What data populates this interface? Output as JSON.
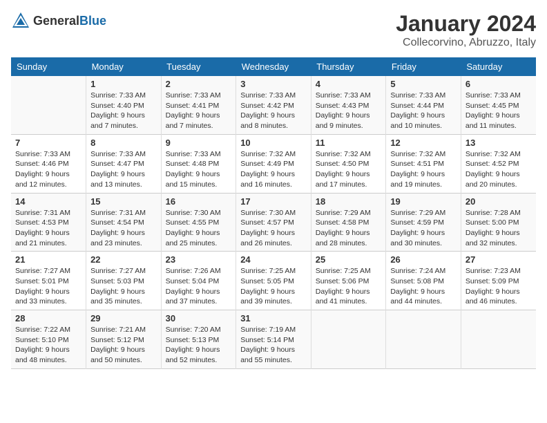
{
  "header": {
    "logo_general": "General",
    "logo_blue": "Blue",
    "title": "January 2024",
    "subtitle": "Collecorvino, Abruzzo, Italy"
  },
  "columns": [
    "Sunday",
    "Monday",
    "Tuesday",
    "Wednesday",
    "Thursday",
    "Friday",
    "Saturday"
  ],
  "weeks": [
    [
      {
        "day": "",
        "detail": ""
      },
      {
        "day": "1",
        "detail": "Sunrise: 7:33 AM\nSunset: 4:40 PM\nDaylight: 9 hours\nand 7 minutes."
      },
      {
        "day": "2",
        "detail": "Sunrise: 7:33 AM\nSunset: 4:41 PM\nDaylight: 9 hours\nand 7 minutes."
      },
      {
        "day": "3",
        "detail": "Sunrise: 7:33 AM\nSunset: 4:42 PM\nDaylight: 9 hours\nand 8 minutes."
      },
      {
        "day": "4",
        "detail": "Sunrise: 7:33 AM\nSunset: 4:43 PM\nDaylight: 9 hours\nand 9 minutes."
      },
      {
        "day": "5",
        "detail": "Sunrise: 7:33 AM\nSunset: 4:44 PM\nDaylight: 9 hours\nand 10 minutes."
      },
      {
        "day": "6",
        "detail": "Sunrise: 7:33 AM\nSunset: 4:45 PM\nDaylight: 9 hours\nand 11 minutes."
      }
    ],
    [
      {
        "day": "7",
        "detail": "Sunrise: 7:33 AM\nSunset: 4:46 PM\nDaylight: 9 hours\nand 12 minutes."
      },
      {
        "day": "8",
        "detail": "Sunrise: 7:33 AM\nSunset: 4:47 PM\nDaylight: 9 hours\nand 13 minutes."
      },
      {
        "day": "9",
        "detail": "Sunrise: 7:33 AM\nSunset: 4:48 PM\nDaylight: 9 hours\nand 15 minutes."
      },
      {
        "day": "10",
        "detail": "Sunrise: 7:32 AM\nSunset: 4:49 PM\nDaylight: 9 hours\nand 16 minutes."
      },
      {
        "day": "11",
        "detail": "Sunrise: 7:32 AM\nSunset: 4:50 PM\nDaylight: 9 hours\nand 17 minutes."
      },
      {
        "day": "12",
        "detail": "Sunrise: 7:32 AM\nSunset: 4:51 PM\nDaylight: 9 hours\nand 19 minutes."
      },
      {
        "day": "13",
        "detail": "Sunrise: 7:32 AM\nSunset: 4:52 PM\nDaylight: 9 hours\nand 20 minutes."
      }
    ],
    [
      {
        "day": "14",
        "detail": "Sunrise: 7:31 AM\nSunset: 4:53 PM\nDaylight: 9 hours\nand 21 minutes."
      },
      {
        "day": "15",
        "detail": "Sunrise: 7:31 AM\nSunset: 4:54 PM\nDaylight: 9 hours\nand 23 minutes."
      },
      {
        "day": "16",
        "detail": "Sunrise: 7:30 AM\nSunset: 4:55 PM\nDaylight: 9 hours\nand 25 minutes."
      },
      {
        "day": "17",
        "detail": "Sunrise: 7:30 AM\nSunset: 4:57 PM\nDaylight: 9 hours\nand 26 minutes."
      },
      {
        "day": "18",
        "detail": "Sunrise: 7:29 AM\nSunset: 4:58 PM\nDaylight: 9 hours\nand 28 minutes."
      },
      {
        "day": "19",
        "detail": "Sunrise: 7:29 AM\nSunset: 4:59 PM\nDaylight: 9 hours\nand 30 minutes."
      },
      {
        "day": "20",
        "detail": "Sunrise: 7:28 AM\nSunset: 5:00 PM\nDaylight: 9 hours\nand 32 minutes."
      }
    ],
    [
      {
        "day": "21",
        "detail": "Sunrise: 7:27 AM\nSunset: 5:01 PM\nDaylight: 9 hours\nand 33 minutes."
      },
      {
        "day": "22",
        "detail": "Sunrise: 7:27 AM\nSunset: 5:03 PM\nDaylight: 9 hours\nand 35 minutes."
      },
      {
        "day": "23",
        "detail": "Sunrise: 7:26 AM\nSunset: 5:04 PM\nDaylight: 9 hours\nand 37 minutes."
      },
      {
        "day": "24",
        "detail": "Sunrise: 7:25 AM\nSunset: 5:05 PM\nDaylight: 9 hours\nand 39 minutes."
      },
      {
        "day": "25",
        "detail": "Sunrise: 7:25 AM\nSunset: 5:06 PM\nDaylight: 9 hours\nand 41 minutes."
      },
      {
        "day": "26",
        "detail": "Sunrise: 7:24 AM\nSunset: 5:08 PM\nDaylight: 9 hours\nand 44 minutes."
      },
      {
        "day": "27",
        "detail": "Sunrise: 7:23 AM\nSunset: 5:09 PM\nDaylight: 9 hours\nand 46 minutes."
      }
    ],
    [
      {
        "day": "28",
        "detail": "Sunrise: 7:22 AM\nSunset: 5:10 PM\nDaylight: 9 hours\nand 48 minutes."
      },
      {
        "day": "29",
        "detail": "Sunrise: 7:21 AM\nSunset: 5:12 PM\nDaylight: 9 hours\nand 50 minutes."
      },
      {
        "day": "30",
        "detail": "Sunrise: 7:20 AM\nSunset: 5:13 PM\nDaylight: 9 hours\nand 52 minutes."
      },
      {
        "day": "31",
        "detail": "Sunrise: 7:19 AM\nSunset: 5:14 PM\nDaylight: 9 hours\nand 55 minutes."
      },
      {
        "day": "",
        "detail": ""
      },
      {
        "day": "",
        "detail": ""
      },
      {
        "day": "",
        "detail": ""
      }
    ]
  ]
}
